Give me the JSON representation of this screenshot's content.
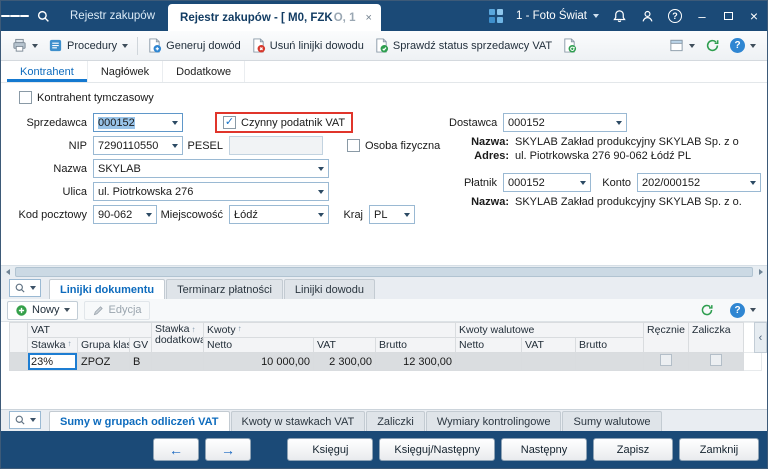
{
  "titlebar": {
    "tab_inactive": "Rejestr zakupów",
    "tab_active": "Rejestr zakupów - [ M0, FZK",
    "tab_active_dim": "O, 1",
    "company": "1 - Foto Świat"
  },
  "toolbar": {
    "procedury": "Procedury",
    "generuj_dowod": "Generuj dowód",
    "usun_linijki": "Usuń linijki dowodu",
    "sprawdz_status": "Sprawdź status sprzedawcy VAT"
  },
  "tabs": {
    "kontrahent": "Kontrahent",
    "naglowek": "Nagłówek",
    "dodatkowe": "Dodatkowe"
  },
  "form": {
    "kontrahent_tymczasowy": "Kontrahent tymczasowy",
    "sprzedawca_label": "Sprzedawca",
    "sprzedawca_value": "000152",
    "czynny_podatnik": "Czynny podatnik VAT",
    "nip_label": "NIP",
    "nip_value": "7290110550",
    "pesel_label": "PESEL",
    "pesel_value": "",
    "osoba_fizyczna": "Osoba fizyczna",
    "nazwa_label": "Nazwa",
    "nazwa_value": "SKYLAB",
    "ulica_label": "Ulica",
    "ulica_value": "ul. Piotrkowska 276",
    "kod_label": "Kod pocztowy",
    "kod_value": "90-062",
    "miejscowosc_label": "Miejscowość",
    "miejscowosc_value": "Łódź",
    "kraj_label": "Kraj",
    "kraj_value": "PL",
    "dostawca_label": "Dostawca",
    "dostawca_value": "000152",
    "dostawca_nazwa_label": "Nazwa:",
    "dostawca_nazwa": "SKYLAB Zakład produkcyjny SKYLAB Sp. z o",
    "dostawca_adres_label": "Adres:",
    "dostawca_adres": "ul. Piotrkowska 276 90-062 Łódź PL",
    "platnik_label": "Płatnik",
    "platnik_value": "000152",
    "konto_label": "Konto",
    "konto_value": "202/000152",
    "platnik_nazwa_label": "Nazwa:",
    "platnik_nazwa": "SKYLAB Zakład produkcyjny SKYLAB Sp. z o."
  },
  "grid_tabs": {
    "linijki_dokumentu": "Linijki dokumentu",
    "terminarz": "Terminarz płatności",
    "linijki_dowodu": "Linijki dowodu"
  },
  "grid_toolbar": {
    "nowy": "Nowy",
    "edycja": "Edycja"
  },
  "grid": {
    "groups": {
      "vat": "VAT",
      "kwoty": "Kwoty",
      "kwoty_walutowe": "Kwoty walutowe",
      "recznie": "Ręcznie",
      "zaliczka": "Zaliczka"
    },
    "columns": {
      "stawka": "Stawka",
      "grupa": "Grupa klas",
      "gv": "GV",
      "stawka_dod_1": "Stawka",
      "stawka_dod_2": "dodatkowa",
      "netto": "Netto",
      "vat": "VAT",
      "brutto": "Brutto",
      "w_netto": "Netto",
      "w_vat": "VAT",
      "w_brutto": "Brutto"
    },
    "row": {
      "stawka": "23%",
      "grupa": "ZPOZ",
      "gv": "B",
      "stawka_dod": "",
      "netto": "10 000,00",
      "vat": "2 300,00",
      "brutto": "12 300,00",
      "w_netto": "",
      "w_vat": "",
      "w_brutto": ""
    }
  },
  "bottom_tabs": {
    "sumy_vat": "Sumy w grupach odliczeń VAT",
    "kwoty_stawki": "Kwoty w stawkach VAT",
    "zaliczki": "Zaliczki",
    "wymiary": "Wymiary kontrolingowe",
    "sumy_walutowe": "Sumy walutowe"
  },
  "footer": {
    "ksieguj": "Księguj",
    "ksieguj_nastepny": "Księguj/Następny",
    "nastepny": "Następny",
    "zapisz": "Zapisz",
    "zamknij": "Zamknij"
  },
  "colors": {
    "titlebar_navy": "#1b4a77",
    "accent_blue": "#1579d0",
    "attention_red": "#e0352b",
    "refresh_green": "#2e9e4f",
    "focus_cell_blue": "#1d7dd2"
  }
}
